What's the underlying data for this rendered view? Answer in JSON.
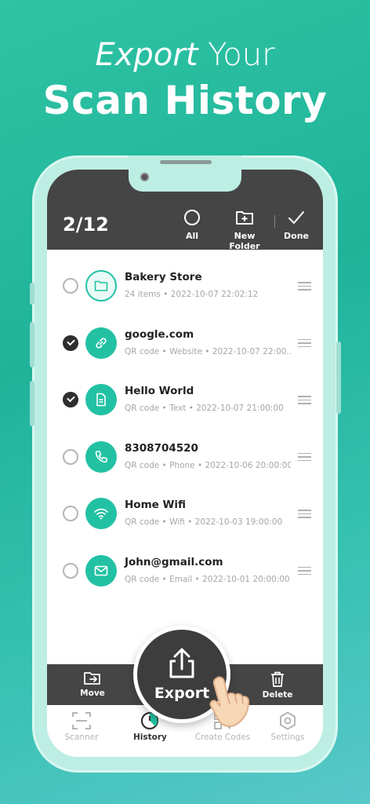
{
  "headline": {
    "italic": "Export",
    "regular": " Your",
    "line2": "Scan History"
  },
  "topbar": {
    "counter": "2/12",
    "all_label": "All",
    "new_folder_label": "New Folder",
    "done_label": "Done"
  },
  "items": [
    {
      "title": "Bakery Store",
      "subtitle": "24 items  •  2022-10-07 22:02:12",
      "icon": "folder-icon",
      "checked": false
    },
    {
      "title": "google.com",
      "subtitle": "QR code  •  Website  •  2022-10-07 22:00...",
      "icon": "link-icon",
      "checked": true
    },
    {
      "title": "Hello World",
      "subtitle": "QR code  •  Text  •  2022-10-07 21:00:00",
      "icon": "document-icon",
      "checked": true
    },
    {
      "title": "8308704520",
      "subtitle": "QR code  •  Phone  •  2022-10-06 20:00:00",
      "icon": "phone-icon",
      "checked": false
    },
    {
      "title": "Home Wifi",
      "subtitle": "QR code  •  Wifi  •  2022-10-03 19:00:00",
      "icon": "wifi-icon",
      "checked": false
    },
    {
      "title": "John@gmail.com",
      "subtitle": "QR code  •  Email  •  2022-10-01 20:00:00",
      "icon": "email-icon",
      "checked": false
    }
  ],
  "bottombar": {
    "move_label": "Move",
    "delete_label": "Delete"
  },
  "export": {
    "label": "Export"
  },
  "tabs": {
    "scanner": "Scanner",
    "history": "History",
    "create_codes": "Create Codes",
    "settings": "Settings"
  },
  "colors": {
    "accent": "#22c1a4",
    "dark_bar": "#454545"
  }
}
